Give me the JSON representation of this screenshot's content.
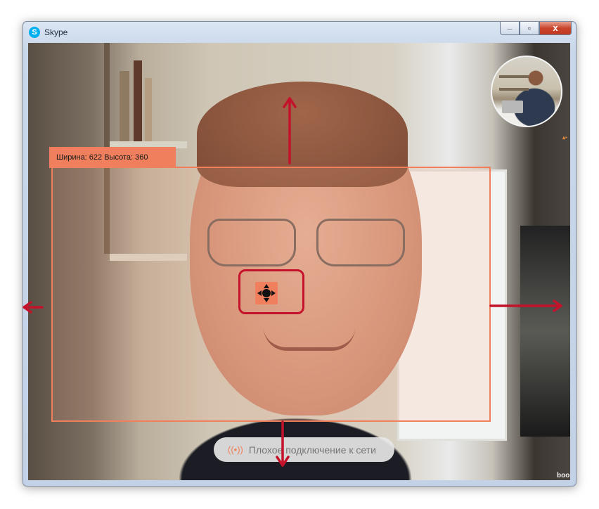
{
  "window": {
    "title": "Skype",
    "app_icon": "skype-icon",
    "controls": {
      "minimize_icon": "minimize-icon",
      "maximize_icon": "maximize-icon",
      "close_icon": "close-icon",
      "minimize_glyph": "_",
      "maximize_glyph": "▫",
      "close_glyph": "x"
    }
  },
  "video": {
    "size_label": "Ширина: 622  Высота: 360",
    "status_text": "Плохое подключение к сети",
    "status_icon": "signal-warning-icon",
    "watermark": "book",
    "move_icon": "move-arrows-icon"
  },
  "colors": {
    "accent": "#f07f5d",
    "highlight_red": "#c4122b",
    "close_red": "#c8462d"
  }
}
